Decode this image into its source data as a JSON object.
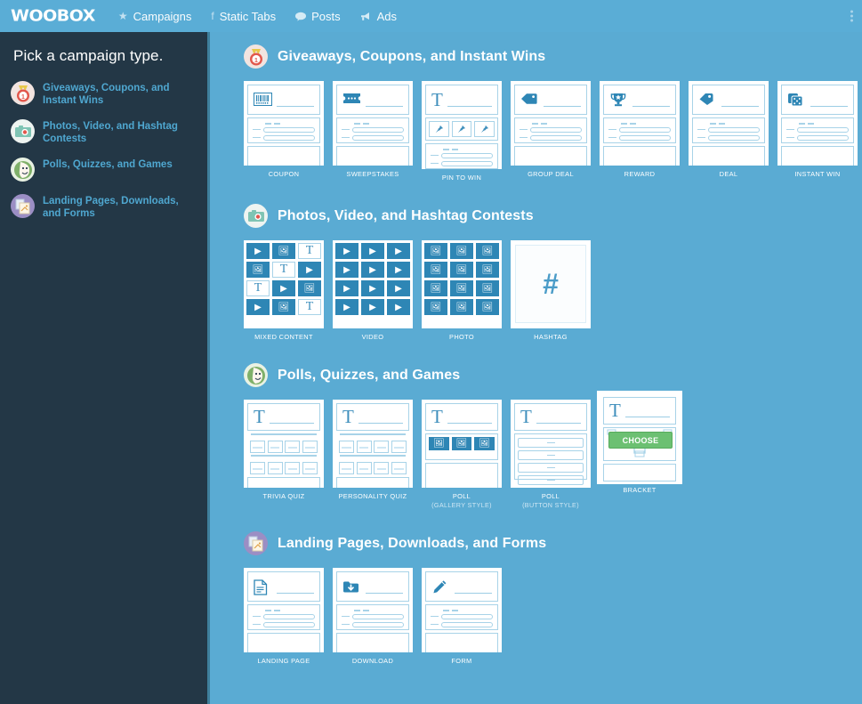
{
  "topbar": {
    "logo": "WOOBOX",
    "nav": [
      {
        "label": "Campaigns",
        "icon": "star-icon",
        "glyph": "★"
      },
      {
        "label": "Static Tabs",
        "icon": "facebook-icon",
        "glyph": "f"
      },
      {
        "label": "Posts",
        "icon": "comment-icon",
        "glyph": "💬"
      },
      {
        "label": "Ads",
        "icon": "megaphone-icon",
        "glyph": "📣"
      }
    ],
    "overflow_menu": "kebab-menu-icon"
  },
  "sidebar": {
    "title": "Pick a campaign type.",
    "items": [
      {
        "label": "Giveaways, Coupons, and Instant Wins",
        "icon": "medal-icon",
        "color": "#e2574c"
      },
      {
        "label": "Photos, Video, and Hashtag Contests",
        "icon": "camera-icon",
        "color": "#7fc4b4"
      },
      {
        "label": "Polls, Quizzes, and Games",
        "icon": "mask-icon",
        "color": "#7fb069"
      },
      {
        "label": "Landing Pages, Downloads, and Forms",
        "icon": "documents-icon",
        "color": "#9b8ec4"
      }
    ]
  },
  "colors": {
    "sidebar_bg": "#233746",
    "main_bg": "#5aabd3",
    "topbar_bg": "#5aadd6",
    "accent_link": "#4fa7d0",
    "choose_green": "#6cc072",
    "card_white": "#ffffff",
    "mock_blue": "#2e86b5"
  },
  "sections": [
    {
      "title": "Giveaways, Coupons, and Instant Wins",
      "icon": "medal-icon",
      "cards": [
        {
          "label": "COUPON",
          "sub": "",
          "icon": "barcode-icon"
        },
        {
          "label": "SWEEPSTAKES",
          "sub": "",
          "icon": "ticket-icon"
        },
        {
          "label": "PIN TO WIN",
          "sub": "",
          "icon": "text-icon"
        },
        {
          "label": "GROUP DEAL",
          "sub": "",
          "icon": "tag-icon"
        },
        {
          "label": "REWARD",
          "sub": "",
          "icon": "trophy-icon"
        },
        {
          "label": "DEAL",
          "sub": "",
          "icon": "tag-icon"
        },
        {
          "label": "INSTANT WIN",
          "sub": "",
          "icon": "dice-icon"
        }
      ]
    },
    {
      "title": "Photos, Video, and Hashtag Contests",
      "icon": "camera-icon",
      "cards": [
        {
          "label": "MIXED CONTENT",
          "sub": "",
          "icon": "mixed-grid-icon"
        },
        {
          "label": "VIDEO",
          "sub": "",
          "icon": "video-grid-icon"
        },
        {
          "label": "PHOTO",
          "sub": "",
          "icon": "photo-grid-icon"
        },
        {
          "label": "HASHTAG",
          "sub": "",
          "icon": "hashtag-icon"
        }
      ]
    },
    {
      "title": "Polls, Quizzes, and Games",
      "icon": "mask-icon",
      "cards": [
        {
          "label": "TRIVIA QUIZ",
          "sub": "",
          "icon": "text-icon"
        },
        {
          "label": "PERSONALITY QUIZ",
          "sub": "",
          "icon": "text-icon"
        },
        {
          "label": "POLL",
          "sub": "(GALLERY STYLE)",
          "icon": "text-icon"
        },
        {
          "label": "POLL",
          "sub": "(BUTTON STYLE)",
          "icon": "text-icon"
        },
        {
          "label": "BRACKET",
          "sub": "",
          "icon": "text-icon",
          "hover": true,
          "hover_button": "CHOOSE"
        }
      ]
    },
    {
      "title": "Landing Pages, Downloads, and Forms",
      "icon": "documents-icon",
      "cards": [
        {
          "label": "LANDING PAGE",
          "sub": "",
          "icon": "document-icon"
        },
        {
          "label": "DOWNLOAD",
          "sub": "",
          "icon": "download-icon"
        },
        {
          "label": "FORM",
          "sub": "",
          "icon": "pencil-icon"
        }
      ]
    }
  ]
}
